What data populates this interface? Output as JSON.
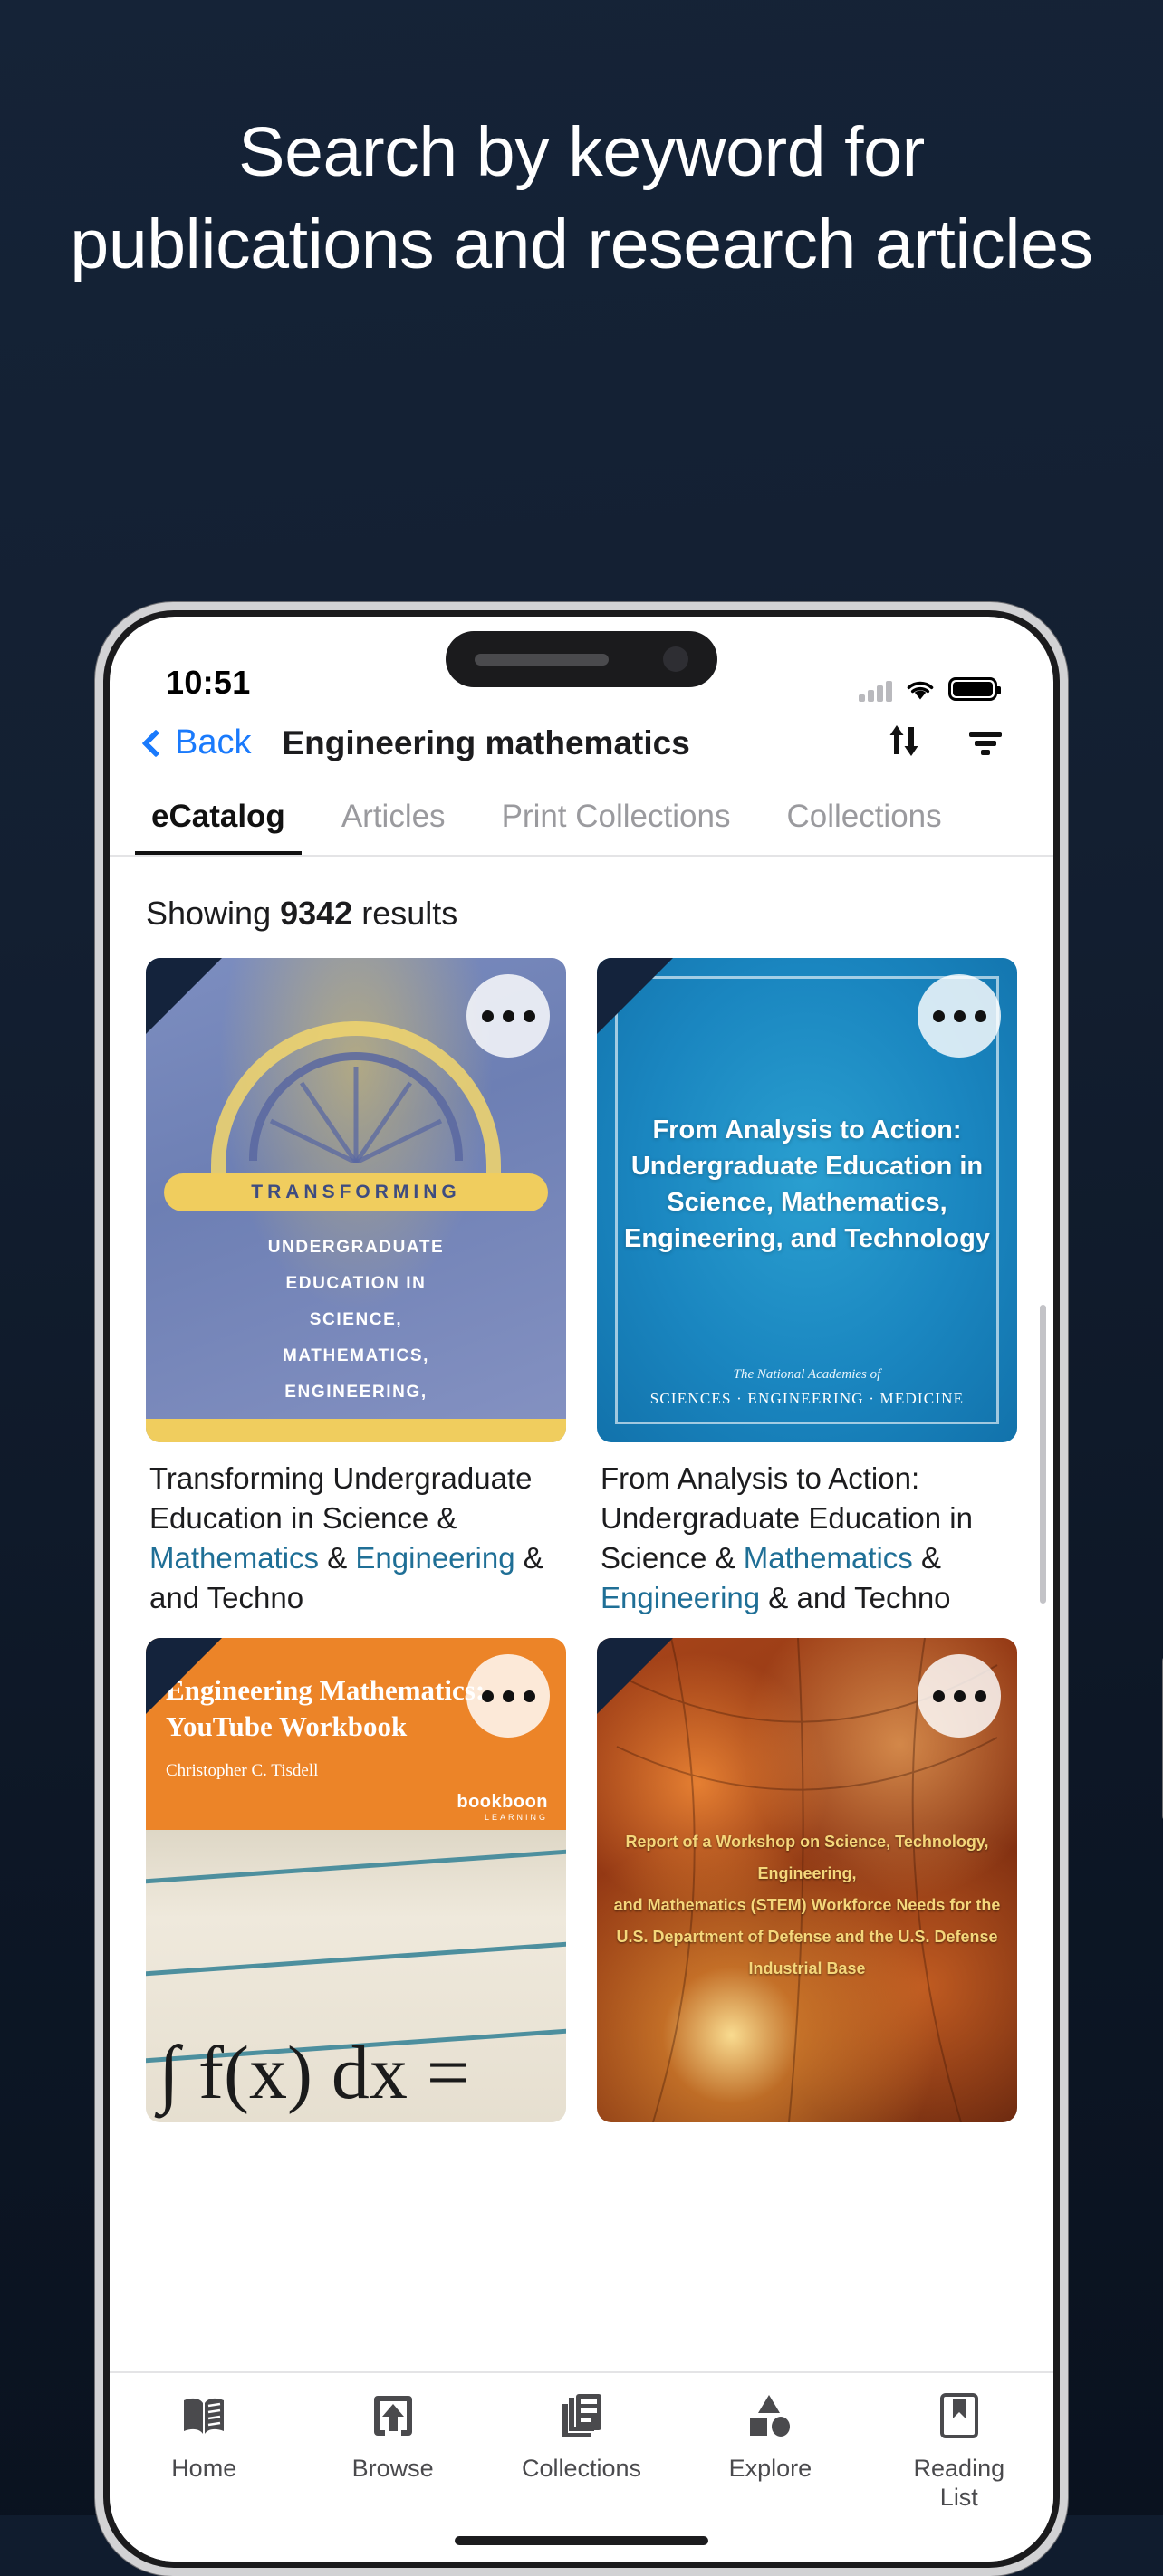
{
  "promo": {
    "headline": "Search by keyword for publications and research articles",
    "background_color": "#101c2e"
  },
  "status_bar": {
    "time": "10:51",
    "cellular_icon": "cellular-bars-icon",
    "wifi_icon": "wifi-icon",
    "battery_icon": "battery-full-icon"
  },
  "nav": {
    "back_label": "Back",
    "title": "Engineering mathematics",
    "sort_icon": "sort-arrows-icon",
    "filter_icon": "filter-icon",
    "accent_color": "#1a7afc"
  },
  "tabs": [
    {
      "label": "eCatalog",
      "active": true
    },
    {
      "label": "Articles",
      "active": false
    },
    {
      "label": "Print Collections",
      "active": false
    },
    {
      "label": "Collections",
      "active": false
    }
  ],
  "results": {
    "prefix": "Showing",
    "count": "9342",
    "suffix": "results"
  },
  "cards": [
    {
      "title_parts": [
        {
          "text": "Transforming Undergraduate Education in Science & ",
          "highlight": false
        },
        {
          "text": "Mathematics",
          "highlight": true
        },
        {
          "text": " & ",
          "highlight": false
        },
        {
          "text": "Engineering",
          "highlight": true
        },
        {
          "text": " & and Techno",
          "highlight": false
        }
      ],
      "cover": {
        "style": "transforming",
        "ribbon": "TRANSFORMING",
        "subtitle": "UNDERGRADUATE\nEDUCATION IN\nSCIENCE,\nMATHEMATICS,\nENGINEERING,\nAND\nTECHNOLOGY"
      },
      "more_icon": "ellipsis-icon"
    },
    {
      "title_parts": [
        {
          "text": "From Analysis to Action: Undergraduate Education in Science & ",
          "highlight": false
        },
        {
          "text": "Mathematics",
          "highlight": true
        },
        {
          "text": " & ",
          "highlight": false
        },
        {
          "text": "Engineering",
          "highlight": true
        },
        {
          "text": " & and Techno",
          "highlight": false
        }
      ],
      "cover": {
        "style": "blue-nap",
        "title": "From Analysis to Action: Undergraduate Education in Science, Mathematics, Engineering, and Technology",
        "imprint_line1": "The National Academies of",
        "imprint_line2": "SCIENCES · ENGINEERING · MEDICINE"
      },
      "more_icon": "ellipsis-icon"
    },
    {
      "cover": {
        "style": "bookboon-orange",
        "title": "Engineering Mathematics: YouTube Workbook",
        "author": "Christopher C. Tisdell",
        "logo": "bookboon",
        "logo_sub": "LEARNING",
        "math": "∫ f(x) dx ="
      },
      "more_icon": "ellipsis-icon"
    },
    {
      "cover": {
        "style": "stem-report",
        "title": "Report of a Workshop on Science, Technology, Engineering, and Mathematics (STEM) Workforce Needs for the U.S. Department of Defense and the U.S. Defense Industrial Base"
      },
      "more_icon": "ellipsis-icon"
    }
  ],
  "bottom_nav": [
    {
      "label": "Home",
      "icon": "open-book-icon"
    },
    {
      "label": "Browse",
      "icon": "upload-device-icon"
    },
    {
      "label": "Collections",
      "icon": "stacked-documents-icon"
    },
    {
      "label": "Explore",
      "icon": "shapes-icon"
    },
    {
      "label": "Reading\nList",
      "icon": "bookmark-icon"
    }
  ]
}
